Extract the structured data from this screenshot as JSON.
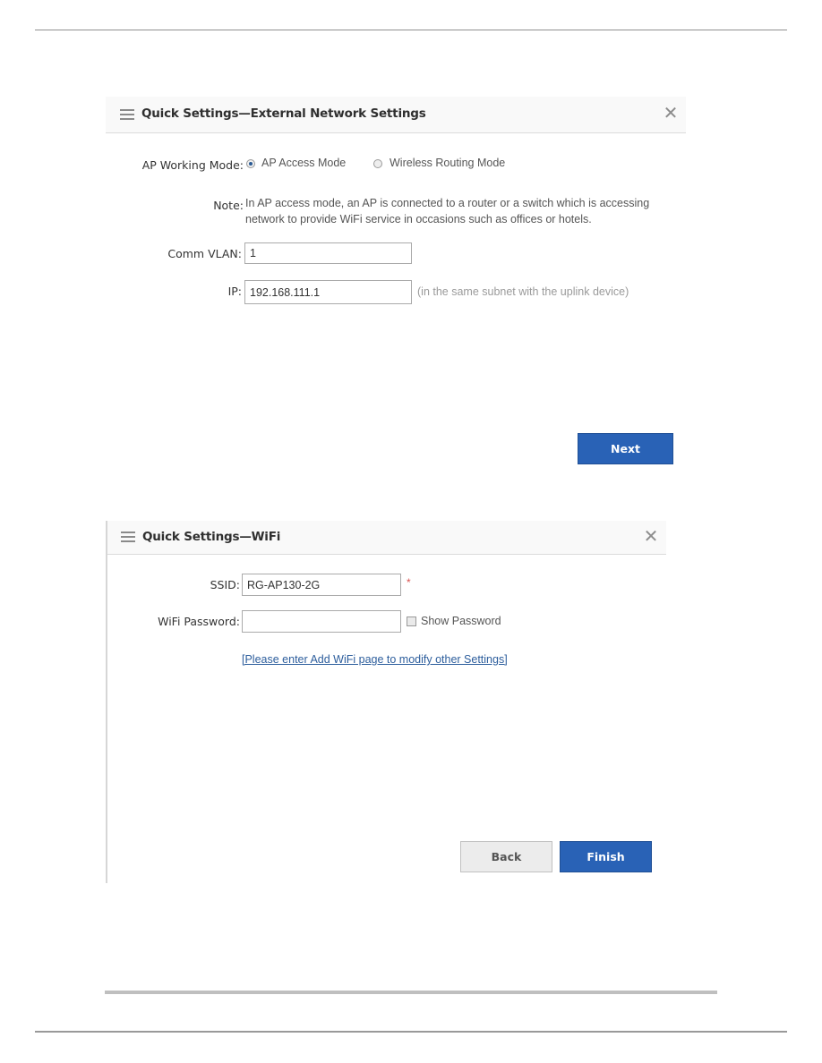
{
  "panel1": {
    "title": "Quick Settings—External Network Settings",
    "mode_label": "AP Working Mode:",
    "modes": [
      {
        "label": "AP Access Mode",
        "checked": true
      },
      {
        "label": "Wireless Routing Mode",
        "checked": false
      }
    ],
    "note_label": "Note:",
    "note_line1": "In AP access mode, an AP is connected to a router or a switch which is accessing",
    "note_line2": "network to provide WiFi service in occasions such as offices or hotels.",
    "vlan_label": "Comm VLAN:",
    "vlan_value": "1",
    "ip_label": "IP:",
    "ip_value": "192.168.111.1",
    "ip_hint": "(in the same subnet with the uplink device)",
    "next_label": "Next"
  },
  "panel2": {
    "title": "Quick Settings—WiFi",
    "ssid_label": "SSID:",
    "ssid_value": "RG-AP130-2G",
    "required_mark": "*",
    "password_label": "WiFi Password:",
    "password_value": "",
    "show_password_label": "Show Password",
    "show_password_checked": false,
    "add_wifi_link": "[Please enter Add WiFi page to modify other Settings]",
    "back_label": "Back",
    "finish_label": "Finish"
  },
  "icons": {
    "menu": "☰",
    "close": "✕"
  },
  "colors": {
    "primary_button": "#2962b6",
    "link": "#2c5d9c",
    "required": "#d9534f"
  }
}
